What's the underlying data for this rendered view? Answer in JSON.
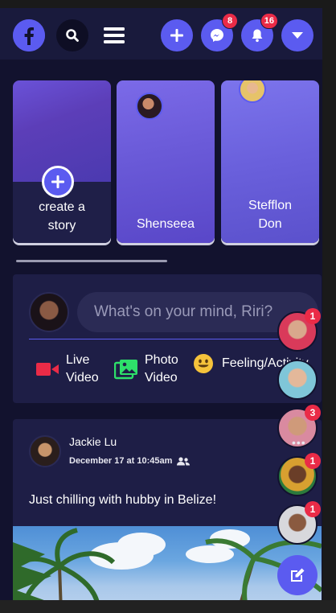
{
  "header": {
    "logo_icon": "facebook-logo-icon",
    "search_icon": "search-icon",
    "menu_icon": "hamburger-menu-icon",
    "create_icon": "plus-icon",
    "messenger_icon": "messenger-icon",
    "messenger_badge": "8",
    "notifications_icon": "bell-icon",
    "notifications_badge": "16",
    "account_icon": "caret-down-icon",
    "accent_color": "#5b5bf0",
    "badge_color": "#ea2b47"
  },
  "stories": [
    {
      "label_line1": "create a",
      "label_line2": "story",
      "type": "create"
    },
    {
      "label": "Shenseea",
      "type": "user"
    },
    {
      "label_line1": "Stefflon",
      "label_line2": "Don",
      "type": "user"
    }
  ],
  "composer": {
    "placeholder": "What's on your mind, Riri?",
    "actions": [
      {
        "icon": "video-camera-icon",
        "line1": "Live",
        "line2": "Video",
        "color": "#ea2b47"
      },
      {
        "icon": "photo-icon",
        "line1": "Photo",
        "line2": "Video",
        "color": "#2ee06a"
      },
      {
        "icon": "smiley-icon",
        "label": "Feeling/Activity",
        "color": "#f5c33b"
      }
    ]
  },
  "post": {
    "author": "Jackie Lu",
    "timestamp": "December 17 at 10:45am",
    "audience_icon": "friends-icon",
    "text": "Just chilling with hubby in Belize!"
  },
  "chat_heads": [
    {
      "badge": "1"
    },
    {
      "badge": ""
    },
    {
      "badge": "3"
    },
    {
      "badge": "1"
    },
    {
      "badge": "1"
    }
  ],
  "compose_message_icon": "edit-icon"
}
